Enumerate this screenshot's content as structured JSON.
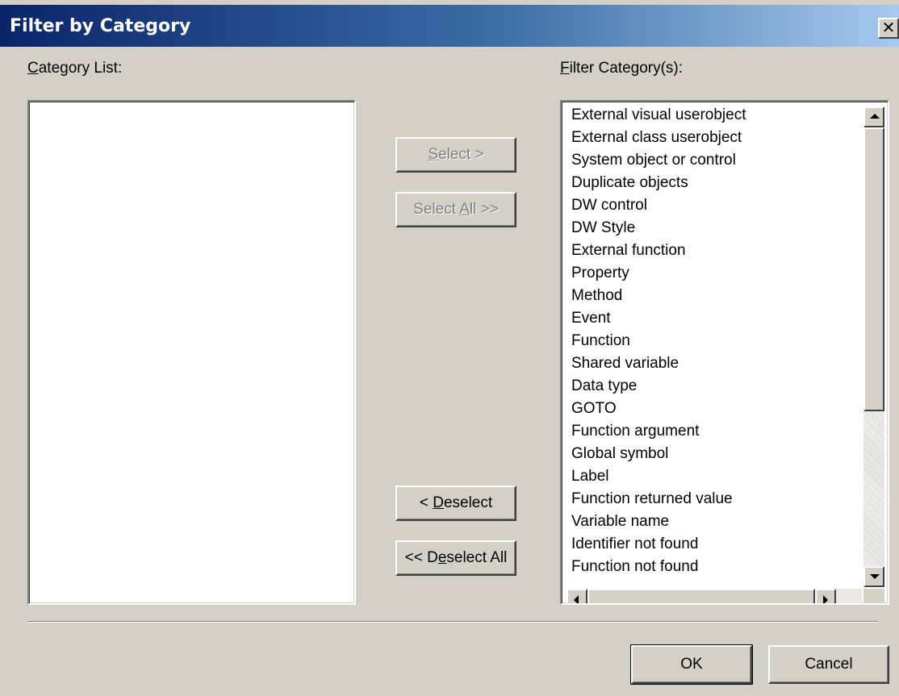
{
  "window": {
    "title": "Filter by Category",
    "close_glyph": "✕"
  },
  "category_list": {
    "label_mnemonic": "C",
    "label_rest": "ategory List:"
  },
  "filter_list": {
    "label_mnemonic": "F",
    "label_rest": "ilter Category(s):",
    "items": [
      "External visual userobject",
      "External class userobject",
      "System object or control",
      "Duplicate objects",
      "DW control",
      "DW Style",
      "External function",
      "Property",
      "Method",
      "Event",
      "Function",
      "Shared variable",
      "Data type",
      "GOTO",
      "Function argument",
      "Global symbol",
      "Label",
      "Function returned value",
      "Variable name",
      "Identifier not found",
      "Function not found"
    ]
  },
  "buttons": {
    "select": {
      "mnemonic": "S",
      "rest": "elect >",
      "enabled": false
    },
    "select_all": {
      "pre": "Select ",
      "mnemonic": "A",
      "rest": "ll >>",
      "enabled": false
    },
    "deselect": {
      "pre": "< ",
      "mnemonic": "D",
      "rest": "eselect",
      "enabled": true
    },
    "deselect_all": {
      "pre": "<< D",
      "mnemonic": "e",
      "rest": "select All",
      "enabled": true
    },
    "ok": "OK",
    "cancel": "Cancel"
  },
  "icons": {
    "scroll_up": "arrow-up-icon",
    "scroll_down": "arrow-down-icon",
    "scroll_left": "arrow-left-icon",
    "scroll_right": "arrow-right-icon"
  },
  "colors": {
    "title_start": "#0a246a",
    "title_end": "#a6caf0",
    "face": "#d4d0c8",
    "disabled_text": "#808080"
  }
}
